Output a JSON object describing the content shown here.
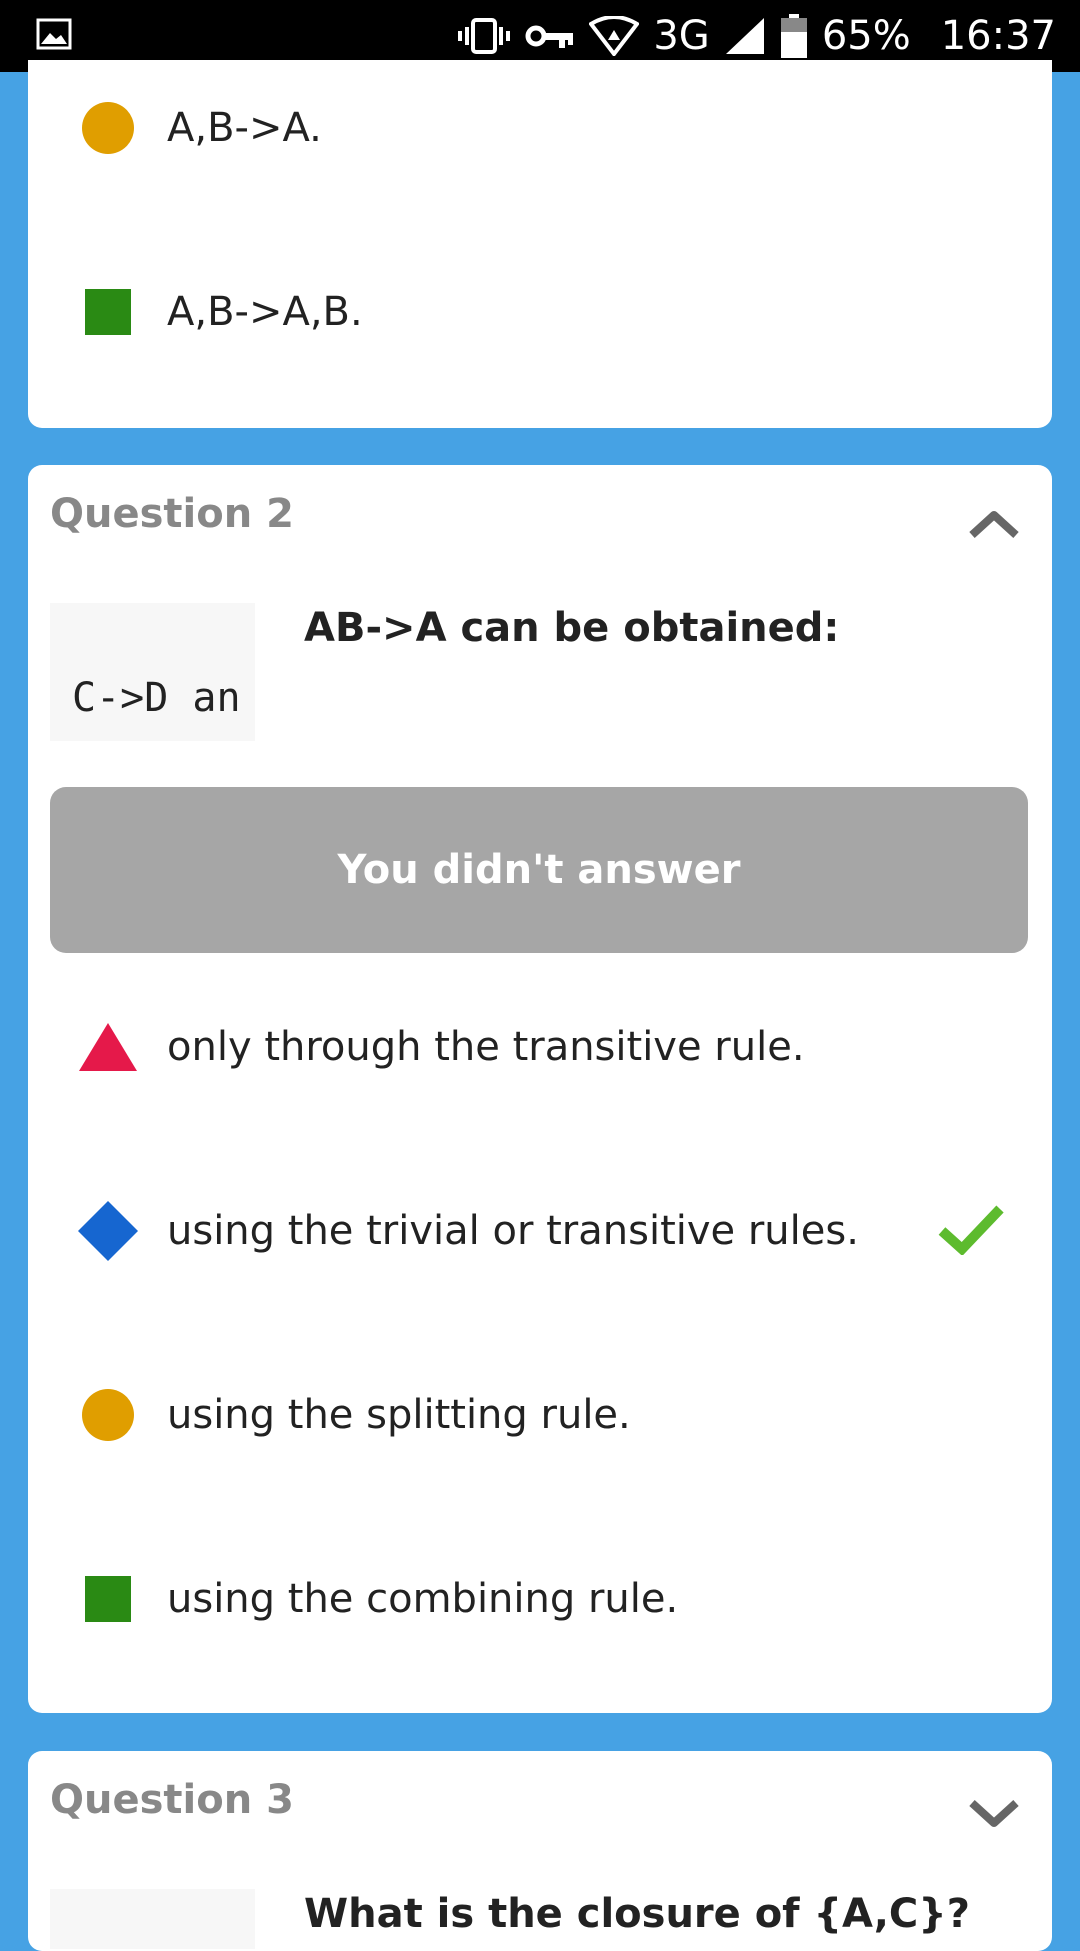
{
  "status_bar": {
    "network": "3G",
    "battery": "65%",
    "time": "16:37"
  },
  "question1_partial": {
    "options": [
      {
        "shape": "circle",
        "color": "#e09e00",
        "text": "A,B->A."
      },
      {
        "shape": "square",
        "color": "#2a8a14",
        "text": "A,B->A,B."
      }
    ]
  },
  "question2": {
    "header": "Question 2",
    "code_snippet": "C->D an",
    "title": "AB->A can be obtained:",
    "answer_status": "You didn't answer",
    "options": [
      {
        "shape": "triangle",
        "color": "#e5194a",
        "text": "only through the transitive rule.",
        "correct": false
      },
      {
        "shape": "diamond",
        "color": "#1666d0",
        "text": "using the trivial or transitive rules.",
        "correct": true
      },
      {
        "shape": "circle",
        "color": "#e09e00",
        "text": "using the splitting rule.",
        "correct": false
      },
      {
        "shape": "square",
        "color": "#2a8a14",
        "text": "using the combining rule.",
        "correct": false
      }
    ]
  },
  "question3": {
    "header": "Question 3",
    "title": "What is the closure of {A,C}?"
  },
  "colors": {
    "background": "#46a2e4",
    "check": "#5dbb2e",
    "banner": "#a6a6a6"
  }
}
